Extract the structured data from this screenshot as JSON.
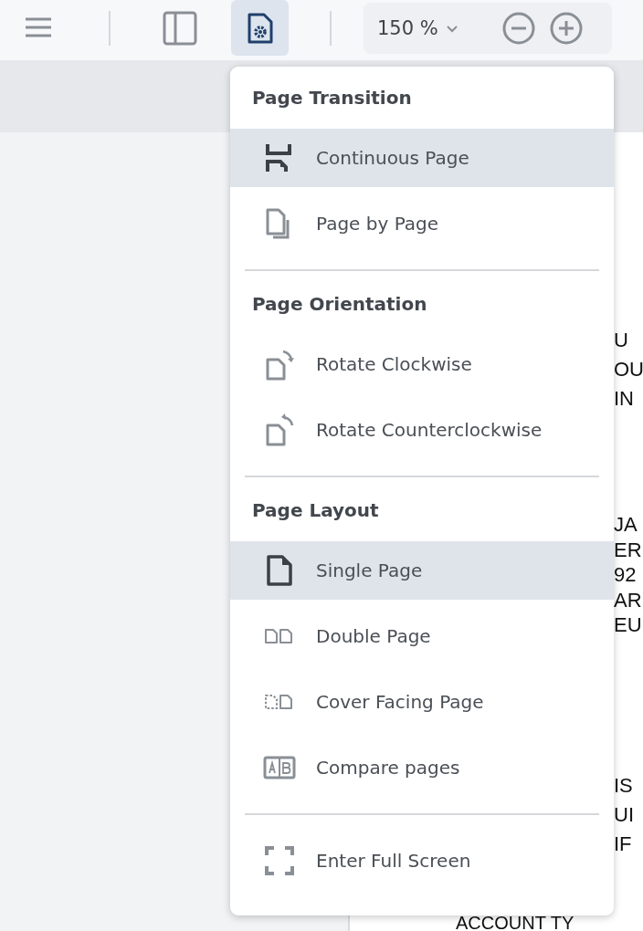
{
  "toolbar": {
    "settings_selected": true,
    "zoom": "150 %"
  },
  "menu": {
    "sections": [
      {
        "title": "Page Transition",
        "items": [
          {
            "label": "Continuous Page",
            "selected": true
          },
          {
            "label": "Page by Page",
            "selected": false
          }
        ]
      },
      {
        "title": "Page Orientation",
        "items": [
          {
            "label": "Rotate Clockwise",
            "selected": false
          },
          {
            "label": "Rotate Counterclockwise",
            "selected": false
          }
        ]
      },
      {
        "title": "Page Layout",
        "items": [
          {
            "label": "Single Page",
            "selected": true
          },
          {
            "label": "Double Page",
            "selected": false
          },
          {
            "label": "Cover Facing Page",
            "selected": false
          },
          {
            "label": "Compare pages",
            "selected": false
          }
        ]
      },
      {
        "items": [
          {
            "label": "Enter Full Screen",
            "selected": false
          }
        ]
      }
    ]
  },
  "document": {
    "line_groups": [
      [
        "U",
        "OU",
        "IN"
      ],
      [
        "JA",
        "ER",
        "92",
        "AR",
        "EU"
      ],
      [
        "IS",
        "UI",
        "IF"
      ]
    ],
    "bottom_line": "ACCOUNT TY"
  }
}
